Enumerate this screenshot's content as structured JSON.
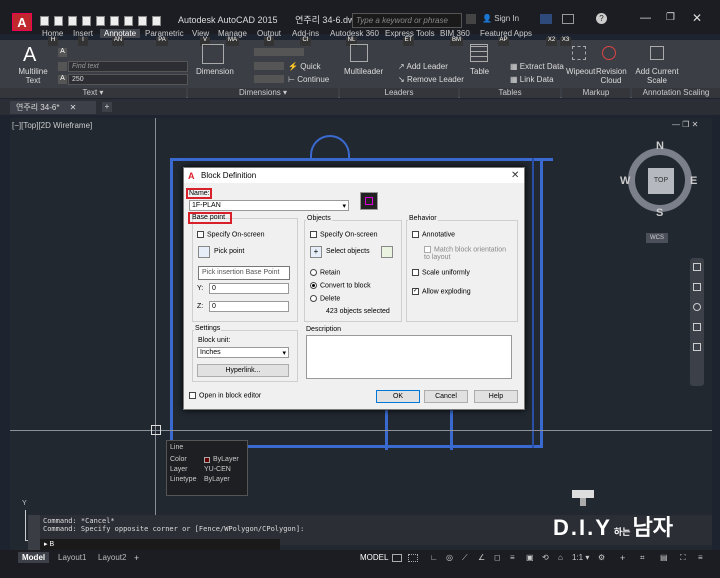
{
  "window": {
    "title": "Autodesk AutoCAD 2015",
    "doc_title": "연주리 34-6.dwg",
    "search_placeholder": "Type a keyword or phrase",
    "sign_in": "Sign In"
  },
  "tabs": [
    "Home",
    "Insert",
    "Annotate",
    "Parametric",
    "View",
    "Manage",
    "Output",
    "Add-ins",
    "Autodesk 360",
    "Express Tools",
    "BIM 360",
    "Featured Apps"
  ],
  "keytips": [
    "H",
    "I",
    "AN",
    "PA",
    "V",
    "MA",
    "O",
    "CI",
    "NL",
    "ET",
    "BM",
    "AP",
    "X2",
    "X3"
  ],
  "ribbon": {
    "multiline_text": "Multiline Text",
    "find_text": "Find text",
    "text_size": "250",
    "dimension": "Dimension",
    "quick": "Quick",
    "continue": "Continue",
    "multileader": "Multileader",
    "add_leader": "Add Leader",
    "remove_leader": "Remove Leader",
    "table": "Table",
    "extract_data": "Extract Data",
    "link_data": "Link Data",
    "wipeout": "Wipeout",
    "revision_cloud": "Revision Cloud",
    "add_scale": "Add Current Scale",
    "panels": [
      "Text ▾",
      "Dimensions ▾",
      "Leaders",
      "Tables",
      "Markup",
      "Annotation Scaling"
    ]
  },
  "doctab": "연주리 34-6*",
  "viewport_label": "[−][Top][2D Wireframe]",
  "viewcube": {
    "n": "N",
    "s": "S",
    "e": "E",
    "w": "W",
    "top": "TOP",
    "wcs": "WCS"
  },
  "dialog": {
    "title": "Block Definition",
    "name_label": "Name:",
    "name_value": "1F-PLAN",
    "base_point": "Base point",
    "specify_onscreen": "Specify On-screen",
    "pick_point": "Pick point",
    "tooltip": "Pick insertion Base Point",
    "y_label": "Y:",
    "y_value": "0",
    "z_label": "Z:",
    "z_value": "0",
    "objects": "Objects",
    "obj_specify": "Specify On-screen",
    "select_objects": "Select objects",
    "retain": "Retain",
    "convert": "Convert to block",
    "delete": "Delete",
    "selected_count": "423 objects selected",
    "behavior": "Behavior",
    "annotative": "Annotative",
    "match_orient": "Match block orientation to layout",
    "scale_uniform": "Scale uniformly",
    "allow_explode": "Allow exploding",
    "settings": "Settings",
    "block_unit": "Block unit:",
    "unit_value": "Inches",
    "hyperlink": "Hyperlink...",
    "description": "Description",
    "open_editor": "Open in block editor",
    "ok": "OK",
    "cancel": "Cancel",
    "help": "Help"
  },
  "props": {
    "title": "Line",
    "rows": [
      [
        "Color",
        "ByLayer"
      ],
      [
        "Layer",
        "YU-CEN"
      ],
      [
        "Linetype",
        "ByLayer"
      ]
    ]
  },
  "command": {
    "line1": "Command: *Cancel*",
    "line2": "Command: Specify opposite corner or [Fence/WPolygon/CPolygon]:",
    "input": "B"
  },
  "status": {
    "model_tab": "Model",
    "layout1": "Layout1",
    "layout2": "Layout2",
    "model": "MODEL",
    "scale": "1:1"
  },
  "watermark": {
    "main": "D.I.Y",
    "small": "하는",
    "tail": "남자"
  }
}
